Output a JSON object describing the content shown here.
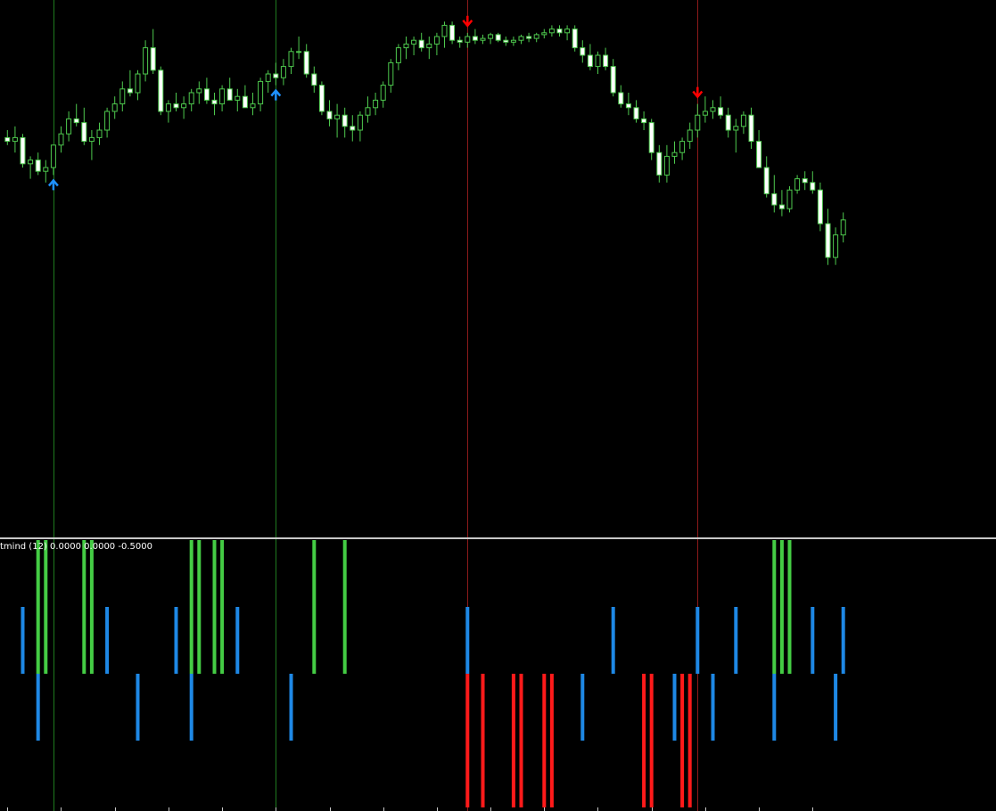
{
  "indicator": {
    "label": "tmind (12) 0.0000 0.0000 -0.5000"
  },
  "colors": {
    "background": "#000000",
    "candle_bull_body": "#000000",
    "candle_bear_body": "#ffffff",
    "candle_outline": "#4ec94e",
    "candle_wick": "#4ec94e",
    "buy_arrow": "#1e90ff",
    "sell_arrow": "#ff0000",
    "buy_vline": "#1f7a1f",
    "sell_vline": "#8b1a1a",
    "hist_green": "#44cc44",
    "hist_blue": "#1e88e5",
    "hist_red": "#ff1a1a",
    "separator": "#c8c8c8"
  },
  "chart_data": {
    "type": "candlestick",
    "title": "",
    "bar_count": 110,
    "price_range": [
      0,
      100
    ],
    "ohlc": [
      [
        68,
        70,
        66,
        67
      ],
      [
        67,
        71,
        64,
        68
      ],
      [
        68,
        69,
        60,
        61
      ],
      [
        61,
        63,
        57,
        62
      ],
      [
        62,
        64,
        58,
        59
      ],
      [
        59,
        62,
        56,
        60
      ],
      [
        60,
        66,
        58,
        66
      ],
      [
        66,
        71,
        64,
        69
      ],
      [
        69,
        75,
        67,
        73
      ],
      [
        73,
        77,
        71,
        72
      ],
      [
        72,
        76,
        66,
        67
      ],
      [
        67,
        70,
        62,
        68
      ],
      [
        68,
        72,
        66,
        70
      ],
      [
        70,
        76,
        68,
        75
      ],
      [
        75,
        79,
        73,
        77
      ],
      [
        77,
        83,
        75,
        81
      ],
      [
        81,
        86,
        79,
        80
      ],
      [
        80,
        86,
        78,
        85
      ],
      [
        85,
        94,
        83,
        92
      ],
      [
        92,
        97,
        85,
        86
      ],
      [
        86,
        87,
        74,
        75
      ],
      [
        75,
        78,
        72,
        77
      ],
      [
        77,
        80,
        75,
        76
      ],
      [
        76,
        79,
        73,
        77
      ],
      [
        77,
        81,
        75,
        80
      ],
      [
        80,
        83,
        77,
        81
      ],
      [
        81,
        84,
        77,
        78
      ],
      [
        78,
        80,
        74,
        77
      ],
      [
        77,
        82,
        75,
        81
      ],
      [
        81,
        84,
        78,
        78
      ],
      [
        78,
        81,
        75,
        79
      ],
      [
        79,
        82,
        76,
        76
      ],
      [
        76,
        80,
        74,
        77
      ],
      [
        77,
        84,
        75,
        83
      ],
      [
        83,
        86,
        80,
        85
      ],
      [
        85,
        88,
        82,
        84
      ],
      [
        84,
        89,
        82,
        87
      ],
      [
        87,
        92,
        85,
        91
      ],
      [
        91,
        95,
        89,
        91
      ],
      [
        91,
        93,
        84,
        85
      ],
      [
        85,
        87,
        80,
        82
      ],
      [
        82,
        83,
        74,
        75
      ],
      [
        75,
        78,
        71,
        73
      ],
      [
        73,
        77,
        68,
        74
      ],
      [
        74,
        76,
        68,
        71
      ],
      [
        71,
        74,
        67,
        70
      ],
      [
        70,
        75,
        67,
        74
      ],
      [
        74,
        79,
        72,
        76
      ],
      [
        76,
        80,
        74,
        78
      ],
      [
        78,
        83,
        76,
        82
      ],
      [
        82,
        89,
        80,
        88
      ],
      [
        88,
        93,
        86,
        92
      ],
      [
        92,
        95,
        89,
        93
      ],
      [
        93,
        95,
        90,
        94
      ],
      [
        94,
        96,
        91,
        92
      ],
      [
        92,
        95,
        89,
        93
      ],
      [
        93,
        96,
        90,
        95
      ],
      [
        95,
        99,
        92,
        98
      ],
      [
        98,
        99,
        93,
        94
      ],
      [
        94,
        95,
        92,
        93.5
      ],
      [
        93.5,
        96,
        92,
        95
      ],
      [
        95,
        97,
        93,
        94
      ],
      [
        94,
        95.5,
        93,
        94.5
      ],
      [
        94.5,
        96,
        93,
        95.5
      ],
      [
        95.5,
        96,
        93.5,
        94
      ],
      [
        94,
        95,
        92.5,
        93.5
      ],
      [
        93.5,
        95,
        92.5,
        94
      ],
      [
        94,
        95.5,
        93,
        95
      ],
      [
        95,
        96,
        93.5,
        94.5
      ],
      [
        94.5,
        96,
        93.5,
        95.5
      ],
      [
        95.5,
        97,
        94.5,
        96
      ],
      [
        96,
        98,
        95,
        97
      ],
      [
        97,
        98,
        95,
        96
      ],
      [
        96,
        98,
        94,
        97
      ],
      [
        97,
        98,
        91,
        92
      ],
      [
        92,
        94,
        88,
        90
      ],
      [
        90,
        93,
        86,
        87
      ],
      [
        87,
        91,
        85,
        90
      ],
      [
        90,
        92,
        86,
        87
      ],
      [
        87,
        89,
        79,
        80
      ],
      [
        80,
        82,
        76,
        77
      ],
      [
        77,
        80,
        74,
        76
      ],
      [
        76,
        78,
        72,
        73
      ],
      [
        73,
        75,
        70,
        72
      ],
      [
        72,
        73,
        62,
        64
      ],
      [
        64,
        66,
        56,
        58
      ],
      [
        58,
        66,
        56,
        63
      ],
      [
        63,
        67,
        61,
        64
      ],
      [
        64,
        68,
        62,
        67
      ],
      [
        67,
        72,
        65,
        70
      ],
      [
        70,
        77,
        68,
        74
      ],
      [
        74,
        79,
        72,
        75
      ],
      [
        75,
        78,
        73,
        76
      ],
      [
        76,
        79,
        73,
        74
      ],
      [
        74,
        76,
        68,
        70
      ],
      [
        70,
        73,
        64,
        71
      ],
      [
        71,
        75,
        69,
        74
      ],
      [
        74,
        76,
        65,
        67
      ],
      [
        67,
        70,
        60,
        60
      ],
      [
        60,
        63,
        52,
        53
      ],
      [
        53,
        58,
        48,
        50
      ],
      [
        50,
        54,
        47,
        49
      ],
      [
        49,
        55,
        48,
        54
      ],
      [
        54,
        58,
        53,
        57
      ],
      [
        57,
        59,
        54,
        56
      ],
      [
        56,
        59,
        53,
        54
      ],
      [
        54,
        56,
        43,
        45
      ],
      [
        45,
        49,
        34,
        36
      ],
      [
        36,
        44,
        34,
        42
      ],
      [
        42,
        48,
        40,
        46
      ]
    ],
    "signals": [
      {
        "bar": 6,
        "type": "buy"
      },
      {
        "bar": 35,
        "type": "buy"
      },
      {
        "bar": 60,
        "type": "sell"
      },
      {
        "bar": 90,
        "type": "sell"
      }
    ],
    "indicator": {
      "name": "tmind (12)",
      "values": [
        0.0,
        0.0,
        -0.5
      ],
      "bars": [
        {
          "bar": 2,
          "type": "blue_up"
        },
        {
          "bar": 4,
          "type": "green"
        },
        {
          "bar": 5,
          "type": "green"
        },
        {
          "bar": 4,
          "type": "blue_down"
        },
        {
          "bar": 10,
          "type": "green"
        },
        {
          "bar": 11,
          "type": "green"
        },
        {
          "bar": 13,
          "type": "blue_up"
        },
        {
          "bar": 17,
          "type": "blue_down"
        },
        {
          "bar": 22,
          "type": "blue_up"
        },
        {
          "bar": 24,
          "type": "green"
        },
        {
          "bar": 25,
          "type": "green"
        },
        {
          "bar": 27,
          "type": "green"
        },
        {
          "bar": 28,
          "type": "green"
        },
        {
          "bar": 30,
          "type": "blue_up"
        },
        {
          "bar": 24,
          "type": "blue_down"
        },
        {
          "bar": 37,
          "type": "blue_down"
        },
        {
          "bar": 40,
          "type": "green"
        },
        {
          "bar": 44,
          "type": "green"
        },
        {
          "bar": 60,
          "type": "blue_up"
        },
        {
          "bar": 60,
          "type": "red"
        },
        {
          "bar": 62,
          "type": "red"
        },
        {
          "bar": 66,
          "type": "red"
        },
        {
          "bar": 67,
          "type": "red"
        },
        {
          "bar": 70,
          "type": "red"
        },
        {
          "bar": 71,
          "type": "red"
        },
        {
          "bar": 75,
          "type": "blue_down"
        },
        {
          "bar": 79,
          "type": "blue_up"
        },
        {
          "bar": 83,
          "type": "red"
        },
        {
          "bar": 84,
          "type": "red"
        },
        {
          "bar": 87,
          "type": "blue_down"
        },
        {
          "bar": 88,
          "type": "red"
        },
        {
          "bar": 89,
          "type": "red"
        },
        {
          "bar": 90,
          "type": "blue_up"
        },
        {
          "bar": 92,
          "type": "blue_down"
        },
        {
          "bar": 95,
          "type": "blue_up"
        },
        {
          "bar": 100,
          "type": "green"
        },
        {
          "bar": 101,
          "type": "green"
        },
        {
          "bar": 102,
          "type": "green"
        },
        {
          "bar": 100,
          "type": "blue_down"
        },
        {
          "bar": 105,
          "type": "blue_up"
        },
        {
          "bar": 108,
          "type": "blue_down"
        },
        {
          "bar": 109,
          "type": "blue_up"
        }
      ]
    }
  }
}
